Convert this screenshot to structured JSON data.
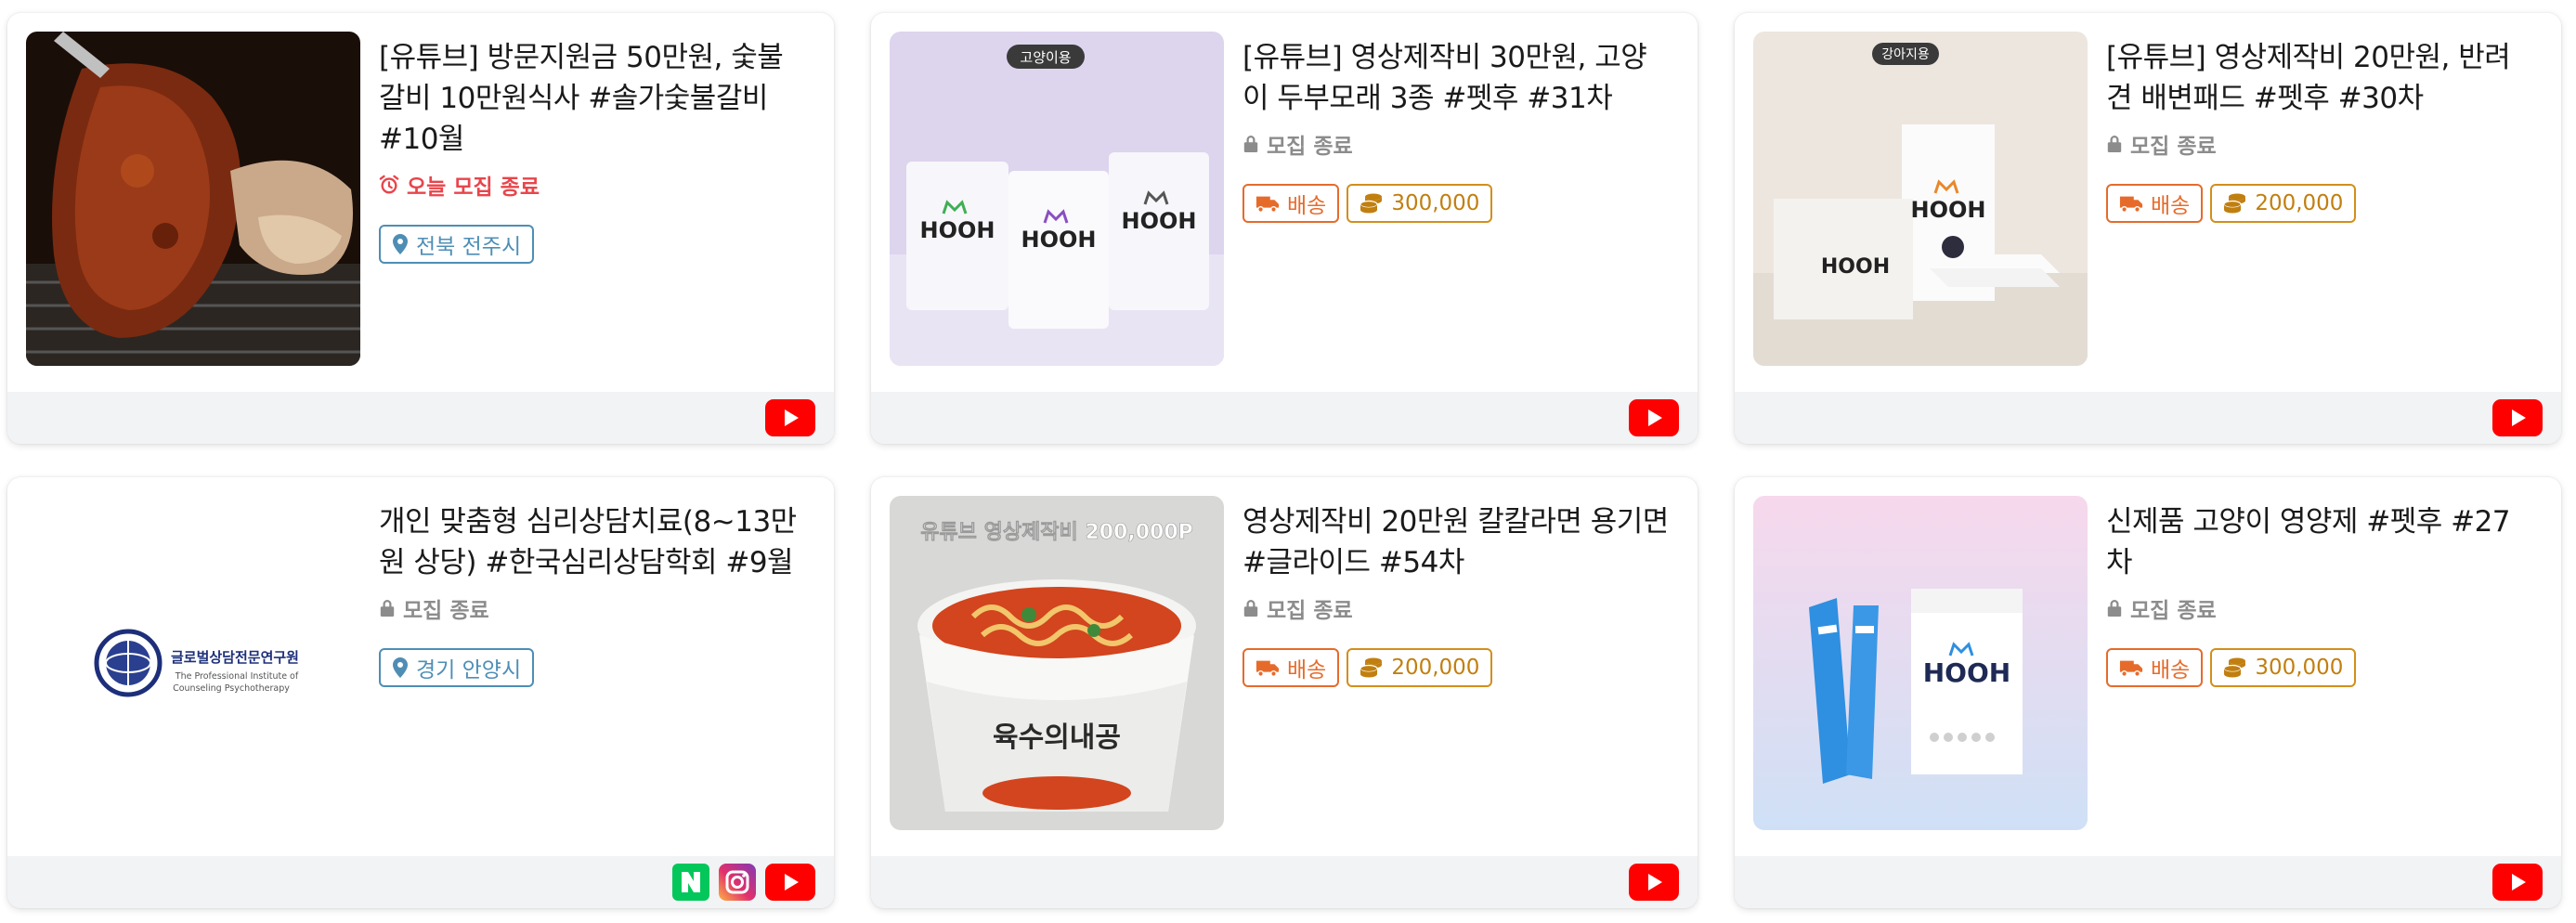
{
  "cards": [
    {
      "title": "[유튜브] 방문지원금 50만원, 숯불갈비 10만원식사 #솔가숯불갈비 #10월",
      "status": "오늘 모집 종료",
      "location": "전북 전주시",
      "channels": [
        "youtube"
      ]
    },
    {
      "title": "[유튜브] 영상제작비 30만원, 고양이 두부모래 3종 #펫후 #31차",
      "status": "모집 종료",
      "badge": "고양이용",
      "brand": "HOOH",
      "ship": "배송",
      "fee": "300,000",
      "channels": [
        "youtube"
      ]
    },
    {
      "title": "[유튜브] 영상제작비 20만원, 반려견 배변패드 #펫후 #30차",
      "status": "모집 종료",
      "badge": "강아지용",
      "brand": "HOOH",
      "ship": "배송",
      "fee": "200,000",
      "channels": [
        "youtube"
      ]
    },
    {
      "title": "개인 맞춤형 심리상담치료(8~13만원 상당) #한국심리상담학회 #9월",
      "status": "모집 종료",
      "location": "경기 안양시",
      "logo_text": "글로벌상담전문연구원",
      "logo_sub1": "The Professional Institute of",
      "logo_sub2": "Counseling Psychotherapy",
      "channels": [
        "naver",
        "instagram",
        "youtube"
      ]
    },
    {
      "title": "영상제작비 20만원 칼칼라면 용기면 #글라이드 #54차",
      "status": "모집 종료",
      "overlay": "유튜브 영상제작비 200,000P",
      "package_text": "육수의내공",
      "ship": "배송",
      "fee": "200,000",
      "channels": [
        "youtube"
      ]
    },
    {
      "title": "신제품 고양이 영양제 #펫후 #27차",
      "status": "모집 종료",
      "brand": "HOOH",
      "ship": "배송",
      "fee": "300,000",
      "channels": [
        "youtube"
      ]
    }
  ],
  "colors": {
    "status_today": "#e8454b",
    "status_closed": "#8c8c8c",
    "tag_location": "#4e8eb5",
    "tag_ship": "#e66b2b",
    "tag_fee": "#d28f1b",
    "youtube": "#ff0000",
    "naver": "#03c75a"
  },
  "icons": [
    "alarm-clock-icon",
    "lock-icon",
    "map-pin-icon",
    "truck-icon",
    "coins-icon",
    "youtube-icon",
    "naver-icon",
    "instagram-icon"
  ]
}
